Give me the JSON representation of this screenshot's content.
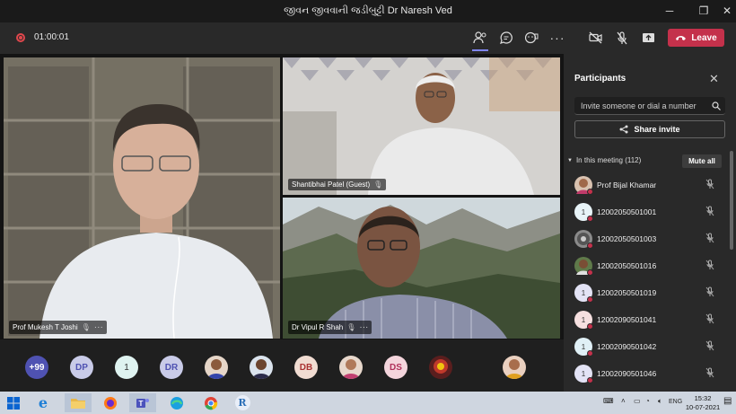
{
  "window": {
    "title": "જીવન જીવવાની જડીબુટ્ટી Dr Naresh Ved"
  },
  "toolbar": {
    "timer": "01:00:01",
    "leave_label": "Leave"
  },
  "tiles": [
    {
      "name": "Prof Mukesh T Joshi"
    },
    {
      "name": "Shantibhai Patel (Guest)"
    },
    {
      "name": "Dr Vipul R Shah"
    }
  ],
  "strip": {
    "overflow": "+99",
    "initials": [
      "DP",
      "1",
      "DR",
      "DB",
      "DS"
    ]
  },
  "panel": {
    "title": "Participants",
    "invite_placeholder": "Invite someone or dial a number",
    "share_label": "Share invite",
    "section_label": "In this meeting (112)",
    "mute_all_label": "Mute all",
    "participants": [
      {
        "name": "Prof Bijal Khamar",
        "initial": ""
      },
      {
        "name": "12002050501001",
        "initial": "1"
      },
      {
        "name": "12002050501003",
        "initial": ""
      },
      {
        "name": "12002050501016",
        "initial": ""
      },
      {
        "name": "12002050501019",
        "initial": "1"
      },
      {
        "name": "12002090501041",
        "initial": "1"
      },
      {
        "name": "12002090501042",
        "initial": "1"
      },
      {
        "name": "12002090501046",
        "initial": "1"
      }
    ]
  },
  "taskbar": {
    "language": "ENG",
    "time": "15:32",
    "date": "10-07-2021"
  }
}
